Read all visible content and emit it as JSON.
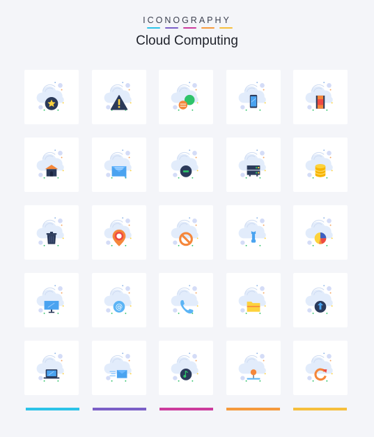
{
  "header": {
    "brand": "ICONOGRAPHY",
    "title": "Cloud Computing",
    "brand_bar_colors": [
      "#2cc3e8",
      "#7b5fc7",
      "#cc3c9d",
      "#f59a3d",
      "#f6bf3d"
    ]
  },
  "icons": [
    {
      "name": "cloud-favorite-icon",
      "glyph": "star"
    },
    {
      "name": "cloud-warning-icon",
      "glyph": "warning"
    },
    {
      "name": "cloud-chat-icon",
      "glyph": "chat"
    },
    {
      "name": "cloud-mobile-icon",
      "glyph": "mobile"
    },
    {
      "name": "cloud-video-icon",
      "glyph": "film"
    },
    {
      "name": "cloud-home-icon",
      "glyph": "home"
    },
    {
      "name": "cloud-mail-icon",
      "glyph": "mail"
    },
    {
      "name": "cloud-remove-icon",
      "glyph": "minus"
    },
    {
      "name": "cloud-server-icon",
      "glyph": "server"
    },
    {
      "name": "cloud-database-icon",
      "glyph": "database"
    },
    {
      "name": "cloud-delete-icon",
      "glyph": "trash"
    },
    {
      "name": "cloud-location-icon",
      "glyph": "pin"
    },
    {
      "name": "cloud-blocked-icon",
      "glyph": "ban"
    },
    {
      "name": "cloud-settings-icon",
      "glyph": "wrench"
    },
    {
      "name": "cloud-analytics-icon",
      "glyph": "pie"
    },
    {
      "name": "cloud-computer-icon",
      "glyph": "monitor"
    },
    {
      "name": "cloud-email-icon",
      "glyph": "at"
    },
    {
      "name": "cloud-call-icon",
      "glyph": "phone"
    },
    {
      "name": "cloud-folder-icon",
      "glyph": "folder"
    },
    {
      "name": "cloud-upload-icon",
      "glyph": "upload"
    },
    {
      "name": "cloud-laptop-icon",
      "glyph": "laptop"
    },
    {
      "name": "cloud-send-mail-icon",
      "glyph": "sendmail"
    },
    {
      "name": "cloud-music-icon",
      "glyph": "music"
    },
    {
      "name": "cloud-network-icon",
      "glyph": "network"
    },
    {
      "name": "cloud-sync-icon",
      "glyph": "refresh"
    }
  ],
  "footer": {
    "bar_colors": [
      "#2cc3e8",
      "#7b5fc7",
      "#cc3c9d",
      "#f59a3d",
      "#f6bf3d"
    ]
  }
}
